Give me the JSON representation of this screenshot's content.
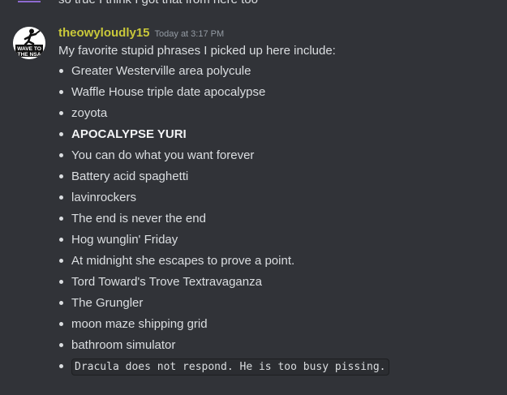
{
  "previous_message": {
    "text": "so true I think I got that from here too"
  },
  "message": {
    "username": "theowyloudly15",
    "timestamp": "Today at 3:17 PM",
    "intro": "My favorite stupid phrases I picked up here include:",
    "avatar_text": [
      "WAVE TO",
      "THE NSA"
    ],
    "items": [
      {
        "text": "Greater Westerville area polycule"
      },
      {
        "text": "Waffle House triple date apocalypse"
      },
      {
        "text": "zoyota"
      },
      {
        "text": "APOCALYPSE YURI"
      },
      {
        "text": "You can do what you want forever"
      },
      {
        "text": "Battery acid spaghetti"
      },
      {
        "text": "lavinrockers"
      },
      {
        "text": "The end is never the end"
      },
      {
        "text": "Hog wunglin' Friday"
      },
      {
        "text": "At midnight she escapes to prove a point."
      },
      {
        "text": "Tord Toward's Trove Textravaganza"
      },
      {
        "text": "The Grungler"
      },
      {
        "text": "moon maze shipping grid"
      },
      {
        "text": "bathroom simulator"
      },
      {
        "text": "Dracula does not respond. He is too busy pissing."
      }
    ]
  },
  "colors": {
    "background": "#313338",
    "username": "#c9c83a",
    "text": "#dbdee1",
    "timestamp": "#949ba4",
    "code_background": "#2b2d31"
  }
}
